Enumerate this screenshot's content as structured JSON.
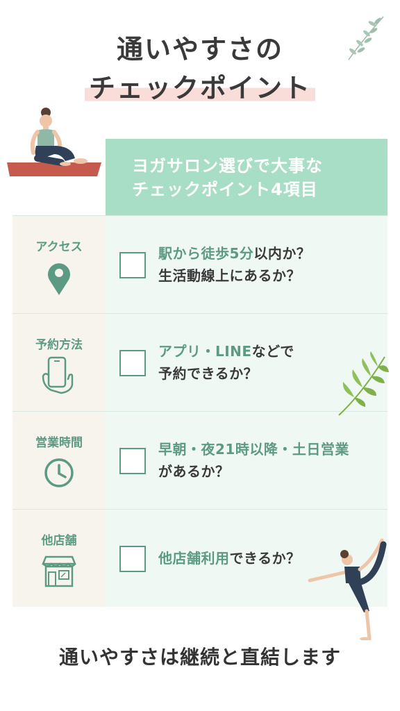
{
  "title": {
    "line1": "通いやすさの",
    "line2": "チェックポイント"
  },
  "header": {
    "line1": "ヨガサロン選びで大事な",
    "line2": "チェックポイント4項目"
  },
  "rows": [
    {
      "label": "アクセス",
      "icon": "map-pin-icon",
      "line1_highlight": "駅から徒歩5分",
      "line1_rest": "以内か？",
      "line2": "生活動線上にあるか？",
      "checked": false
    },
    {
      "label": "予約方法",
      "icon": "smartphone-hand-icon",
      "line1_highlight": "アプリ・LINE",
      "line1_rest": "などで",
      "line2": "予約できるか？",
      "checked": false
    },
    {
      "label": "営業時間",
      "icon": "clock-icon",
      "line1_highlight": "早朝・夜21時以降・土日営業",
      "line1_rest": "",
      "line2": "があるか？",
      "checked": false
    },
    {
      "label": "他店舗",
      "icon": "storefront-icon",
      "line1_highlight": "他店舗利用",
      "line1_rest": "できるか？",
      "line2": "",
      "checked": false
    }
  ],
  "footer": "通いやすさは継続と直結します",
  "colors": {
    "accent_green": "#5d9a84",
    "header_bg": "#a8ddc6",
    "label_bg": "#f7f4ed",
    "content_bg": "#f0f8f4",
    "title_highlight": "#f8ddd8"
  }
}
